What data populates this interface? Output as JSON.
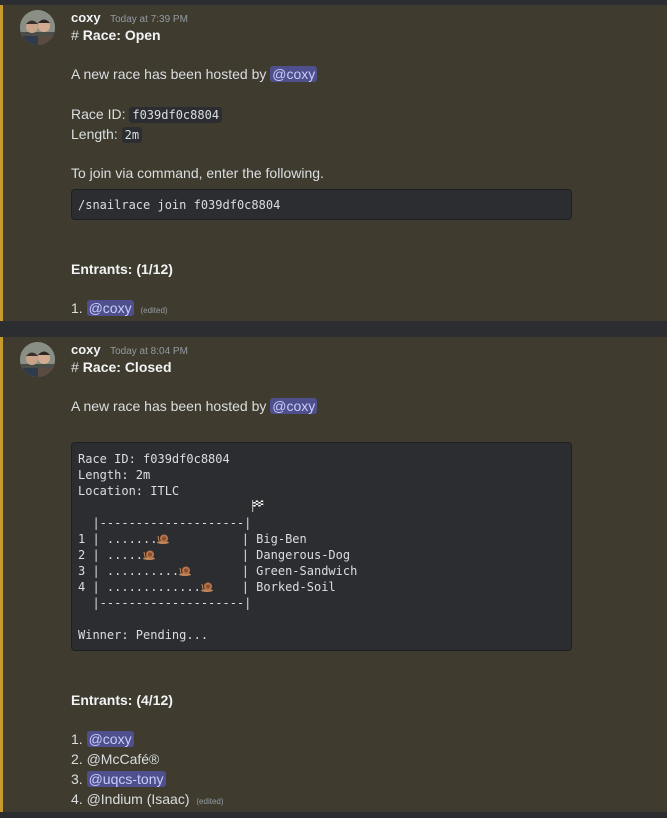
{
  "messages": [
    {
      "username": "coxy",
      "timestamp": "Today at 7:39 PM",
      "heading": "Race: Open",
      "hosted_text": "A new race has been hosted by",
      "hosted_mention": "@coxy",
      "race_id_label": "Race ID:",
      "race_id_value": "f039df0c8804",
      "length_label": "Length:",
      "length_value": "2m",
      "join_text": "To join via command, enter the following.",
      "command": "/snailrace join f039df0c8804",
      "entrants_heading": "Entrants: (1/12)",
      "entrants": [
        {
          "num": "1.",
          "name": "@coxy",
          "mention": true
        }
      ],
      "edited_label": "(edited)"
    },
    {
      "username": "coxy",
      "timestamp": "Today at 8:04 PM",
      "heading": "Race: Closed",
      "hosted_text": "A new race has been hosted by",
      "hosted_mention": "@coxy",
      "race_block": {
        "race_id": "Race ID: f039df0c8804",
        "length": "Length: 2m",
        "location": "Location: ITLC",
        "border": "|--------------------|",
        "lanes": [
          {
            "num": "1 | ",
            "track": ".......",
            "pad": "          ",
            "name": "| Big-Ben"
          },
          {
            "num": "2 | ",
            "track": ".....",
            "pad": "            ",
            "name": "| Dangerous-Dog"
          },
          {
            "num": "3 | ",
            "track": "..........",
            "pad": "       ",
            "name": "| Green-Sandwich"
          },
          {
            "num": "4 | ",
            "track": ".............",
            "pad": "    ",
            "name": "| Borked-Soil"
          }
        ],
        "winner": "Winner: Pending..."
      },
      "entrants_heading": "Entrants: (4/12)",
      "entrants": [
        {
          "num": "1.",
          "name": "@coxy",
          "mention": true
        },
        {
          "num": "2.",
          "name": "@McCafé®",
          "mention": false
        },
        {
          "num": "3.",
          "name": "@uqcs-tony",
          "mention": true
        },
        {
          "num": "4.",
          "name": "@Indium (Isaac)",
          "mention": false
        }
      ],
      "edited_label": "(edited)"
    }
  ],
  "colors": {
    "message_bg": "#3f3c2f",
    "accent_bar": "#c69b2c",
    "mention_bg": "#4e4f8c",
    "code_bg": "#2b2d31"
  }
}
